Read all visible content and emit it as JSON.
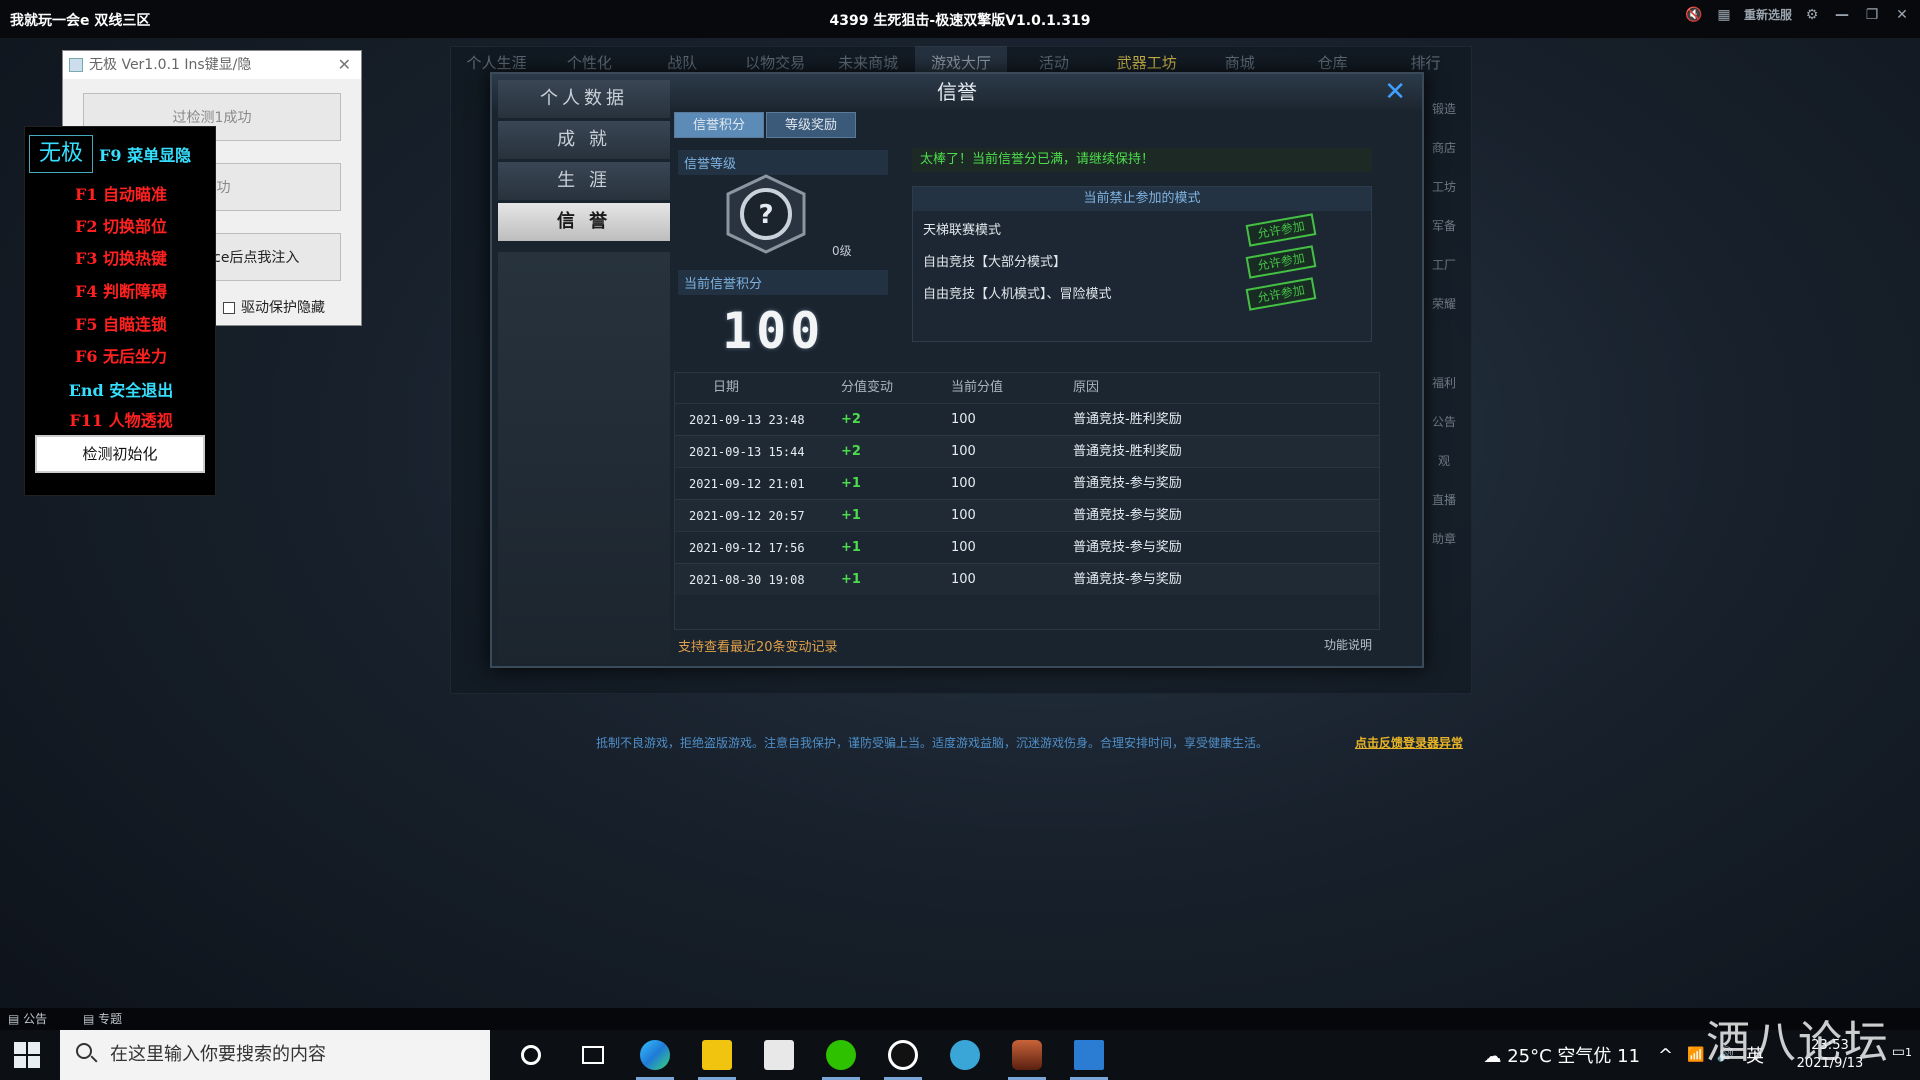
{
  "window": {
    "left_title": "我就玩一会e 双线三区",
    "title": "4399 生死狙击-极速双擎版V1.0.1.319",
    "reselect_label": "重新选服"
  },
  "game_nav": [
    "个人生涯",
    "个性化",
    "战队",
    "以物交易",
    "未来商城",
    "游戏大厅",
    "活动",
    "武器工坊",
    "商城",
    "仓库",
    "排行"
  ],
  "right_side": [
    "锻造",
    "商店",
    "工坊",
    "军备",
    "工厂",
    "荣耀",
    "福利",
    "公告",
    "观",
    "直播",
    "助章"
  ],
  "dialog": {
    "title": "信誉",
    "side_menu": [
      "个人数据",
      "成  就",
      "生  涯",
      "信  誉"
    ],
    "tabs": [
      "信誉积分",
      "等级奖励"
    ],
    "rank_label": "信誉等级",
    "level": "0级",
    "score_label": "当前信誉积分",
    "score": "100",
    "notice": "太棒了！当前信誉分已满，请继续保持！",
    "modes_title": "当前禁止参加的模式",
    "modes": [
      {
        "name": "天梯联赛模式",
        "btn": "允许参加"
      },
      {
        "name": "自由竞技【大部分模式】",
        "btn": "允许参加"
      },
      {
        "name": "自由竞技【人机模式】、冒险模式",
        "btn": "允许参加"
      }
    ],
    "columns": [
      "日期",
      "分值变动",
      "当前分值",
      "原因"
    ],
    "records": [
      {
        "date": "2021-09-13 23:48",
        "change": "+2",
        "value": "100",
        "reason": "普通竞技-胜利奖励"
      },
      {
        "date": "2021-09-13 15:44",
        "change": "+2",
        "value": "100",
        "reason": "普通竞技-胜利奖励"
      },
      {
        "date": "2021-09-12 21:01",
        "change": "+1",
        "value": "100",
        "reason": "普通竞技-参与奖励"
      },
      {
        "date": "2021-09-12 20:57",
        "change": "+1",
        "value": "100",
        "reason": "普通竞技-参与奖励"
      },
      {
        "date": "2021-09-12 17:56",
        "change": "+1",
        "value": "100",
        "reason": "普通竞技-参与奖励"
      },
      {
        "date": "2021-08-30 19:08",
        "change": "+1",
        "value": "100",
        "reason": "普通竞技-参与奖励"
      }
    ],
    "footer_note": "支持查看最近20条变动记录",
    "footer_help": "功能说明"
  },
  "bottom_tip": "抵制不良游戏，拒绝盗版游戏。注意自我保护，谨防受骗上当。适度游戏益脑，沉迷游戏伤身。合理安排时间，享受健康生活。",
  "bottom_link": "点击反馈登录器异常",
  "tool": {
    "title": "无极 Ver1.0.1  Ins键显/隐",
    "btn1": "过检测1成功",
    "btn2": "2成功",
    "btn3": "ace后点我注入",
    "check": "驱动保护隐藏"
  },
  "cheat": {
    "logo": "无极",
    "f9": "F9 菜单显隐",
    "items": [
      "F1 自动瞄准",
      "F2 切换部位",
      "F3 切换热键",
      "F4 判断障碍",
      "F5 自瞄连锁",
      "F6 无后坐力",
      "End 安全退出",
      "F11 人物透视"
    ],
    "init_btn": "检测初始化"
  },
  "game_status": [
    "公告",
    "专题"
  ],
  "taskbar": {
    "search_placeholder": "在这里输入你要搜索的内容",
    "weather": "25°C 空气优 11",
    "time": "23:53",
    "date": "2021/9/13",
    "ime": "英",
    "notif_count": "1"
  },
  "watermark": "酒八论坛",
  "colors": {
    "accent": "#3fa0ff",
    "positive": "#4ddc4d",
    "warning": "#e0a14a",
    "cheat_red": "#ff2020",
    "cheat_cyan": "#35e0ff"
  }
}
